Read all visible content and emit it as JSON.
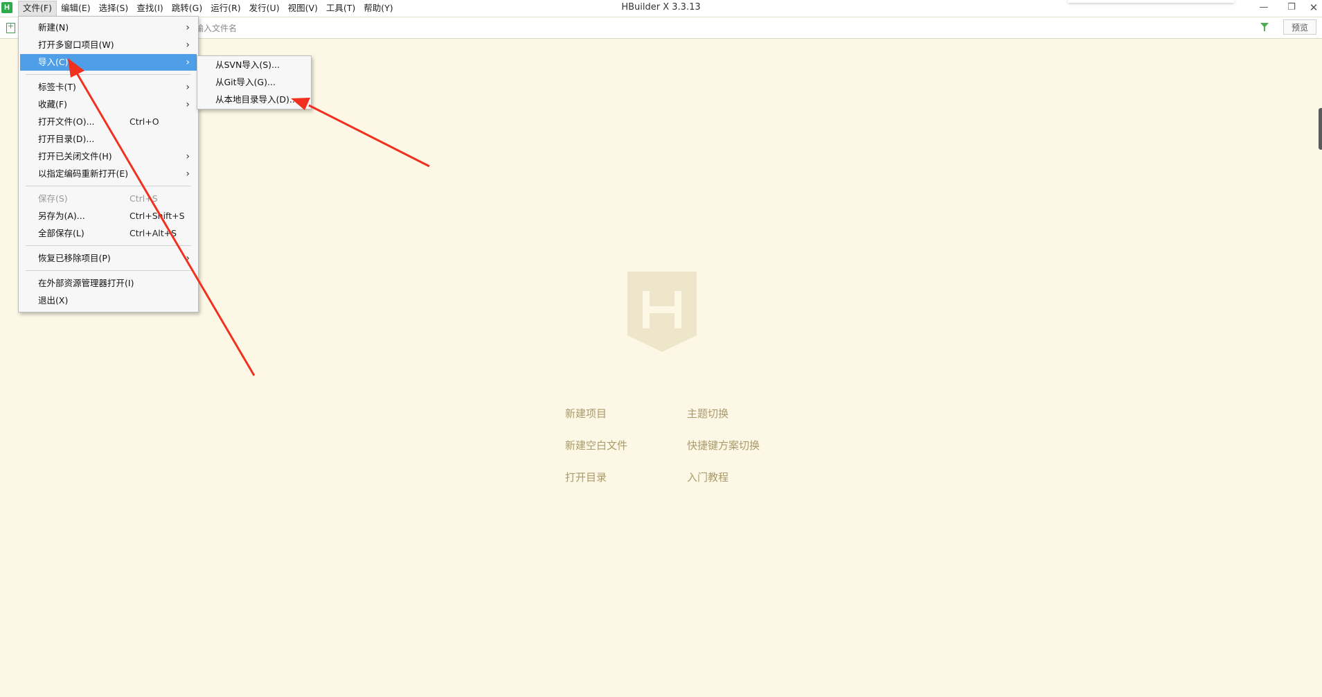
{
  "window": {
    "title": "HBuilder X 3.3.13",
    "logo_letter": "H",
    "min_glyph": "—",
    "max_glyph": "❐",
    "close_glyph": "✕"
  },
  "menubar": [
    {
      "label": "文件(F)",
      "active": true
    },
    {
      "label": "编辑(E)"
    },
    {
      "label": "选择(S)"
    },
    {
      "label": "查找(I)"
    },
    {
      "label": "跳转(G)"
    },
    {
      "label": "运行(R)"
    },
    {
      "label": "发行(U)"
    },
    {
      "label": "视图(V)"
    },
    {
      "label": "工具(T)"
    },
    {
      "label": "帮助(Y)"
    }
  ],
  "toolbar": {
    "search_placeholder": "输入文件名",
    "preview_label": "预览"
  },
  "file_menu": [
    {
      "label": "新建(N)",
      "submenu": true
    },
    {
      "label": "打开多窗口项目(W)",
      "submenu": true
    },
    {
      "label": "导入(C)",
      "submenu": true,
      "highlighted": true
    },
    {
      "label": "标签卡(T)",
      "submenu": true
    },
    {
      "label": "收藏(F)",
      "submenu": true
    },
    {
      "label": "打开文件(O)...",
      "shortcut": "Ctrl+O"
    },
    {
      "label": "打开目录(D)..."
    },
    {
      "label": "打开已关闭文件(H)",
      "submenu": true
    },
    {
      "label": "以指定编码重新打开(E)",
      "submenu": true
    },
    {
      "label": "保存(S)",
      "shortcut": "Ctrl+S",
      "disabled": true
    },
    {
      "label": "另存为(A)...",
      "shortcut": "Ctrl+Shift+S"
    },
    {
      "label": "全部保存(L)",
      "shortcut": "Ctrl+Alt+S"
    },
    {
      "label": "恢复已移除项目(P)",
      "submenu": true
    },
    {
      "label": "在外部资源管理器打开(I)"
    },
    {
      "label": "退出(X)"
    }
  ],
  "import_submenu": [
    {
      "label": "从SVN导入(S)..."
    },
    {
      "label": "从Git导入(G)..."
    },
    {
      "label": "从本地目录导入(D)..."
    }
  ],
  "welcome": {
    "links": [
      "新建项目",
      "主题切换",
      "新建空白文件",
      "快捷键方案切换",
      "打开目录",
      "入门教程"
    ]
  },
  "colors": {
    "background": "#FDF8E6",
    "menu_highlight": "#4F9EE8",
    "welcome_text": "#A99A6B",
    "logo_fill": "#EEE6CA",
    "annotation_arrow": "#F2301F"
  },
  "icons": {
    "submenu_arrow": "›",
    "logo": "hbuilder-logo",
    "new_file": "new-file-icon",
    "filter": "filter-icon"
  }
}
